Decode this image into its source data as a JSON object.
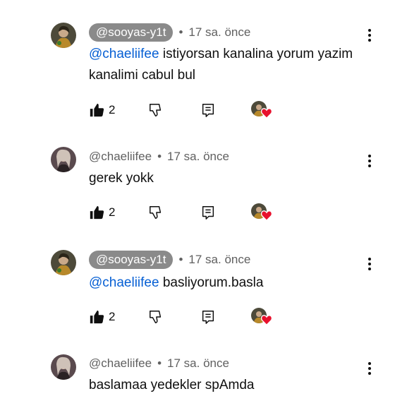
{
  "comments": [
    {
      "author": "@sooyas-y1t",
      "author_highlighted": true,
      "time": "17 sa. önce",
      "mention": "@chaeliifee",
      "text": " istiyorsan kanalina yorum yazim kanalimi cabul bul",
      "likes": "2",
      "avatar": "avatar-sooyas"
    },
    {
      "author": "@chaeliifee",
      "author_highlighted": false,
      "time": "17 sa. önce",
      "mention": "",
      "text": "gerek yokk",
      "likes": "2",
      "avatar": "avatar-chaeliifee"
    },
    {
      "author": "@sooyas-y1t",
      "author_highlighted": true,
      "time": "17 sa. önce",
      "mention": "@chaeliifee",
      "text": " basliyorum.basla",
      "likes": "2",
      "avatar": "avatar-sooyas"
    },
    {
      "author": "@chaeliifee",
      "author_highlighted": false,
      "time": "17 sa. önce",
      "mention": "",
      "text": "baslamaa yedekler spAmda",
      "likes": "",
      "avatar": "avatar-chaeliifee"
    }
  ],
  "separator": "•",
  "icons": {
    "like": "thumbs-up-filled-icon",
    "dislike": "thumbs-down-outline-icon",
    "reply": "reply-comment-icon",
    "hearted": "creator-heart-icon",
    "more": "more-vertical-icon"
  },
  "colors": {
    "mention": "#065fd4",
    "pill": "#8a8a8a",
    "heart": "#e8112d",
    "meta": "#606060"
  }
}
